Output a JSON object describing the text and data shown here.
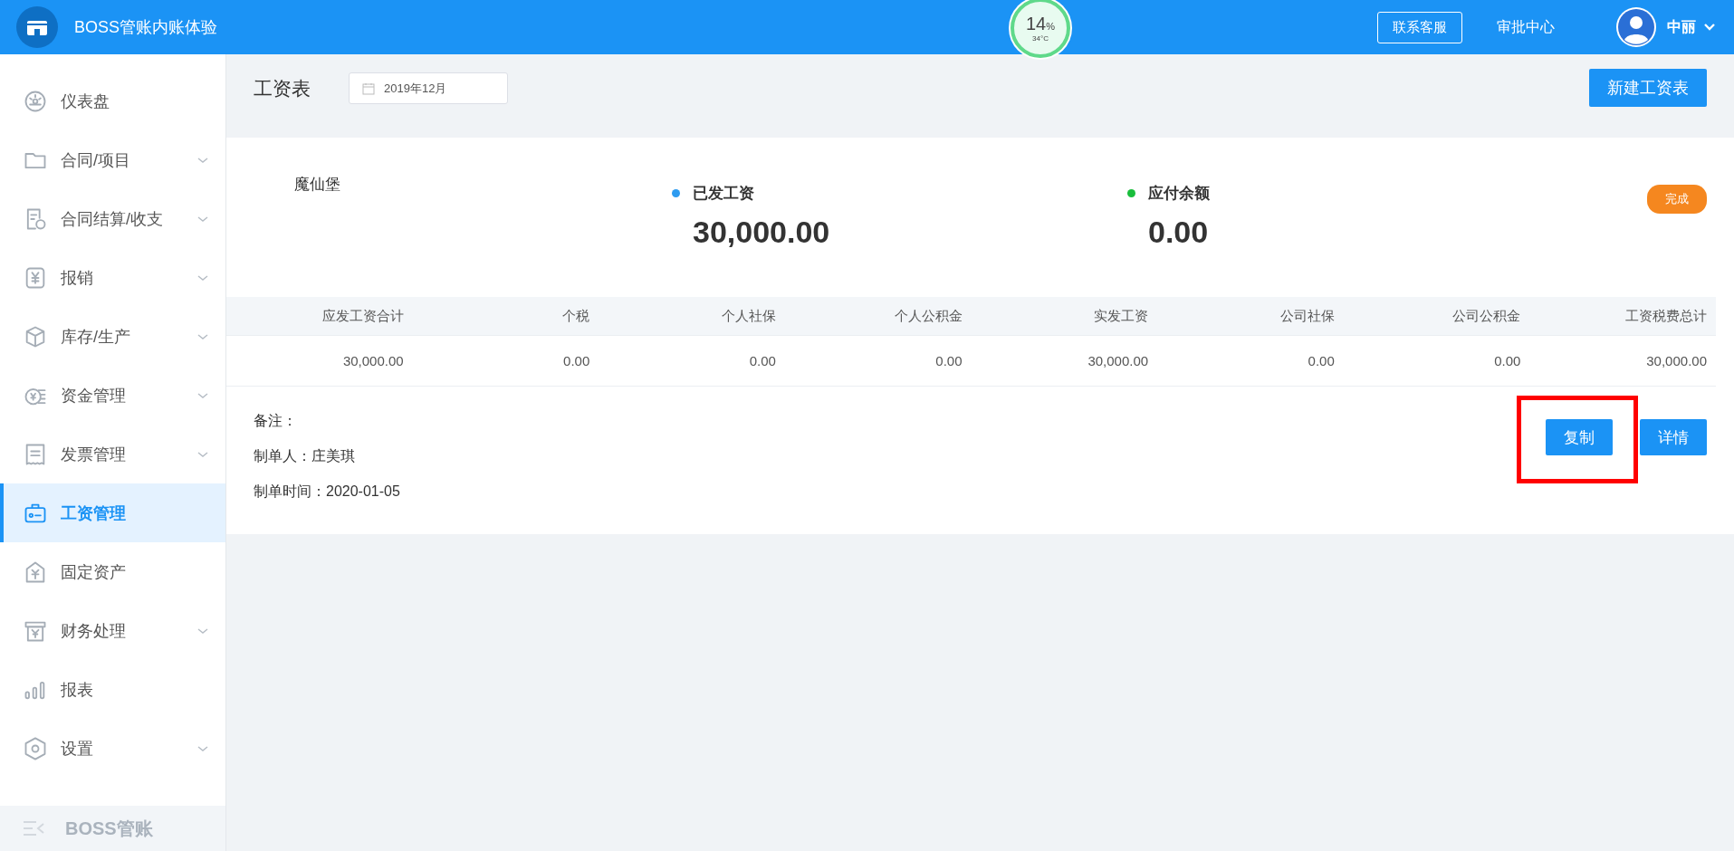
{
  "header": {
    "title": "BOSS管账内账体验",
    "gauge": {
      "value": "14",
      "unit": "%",
      "temperature": "34°C"
    },
    "service_button": "联系客服",
    "approval_link": "审批中心",
    "user": "中丽"
  },
  "sidebar": {
    "items": [
      {
        "label": "仪表盘",
        "expandable": false,
        "selected": false
      },
      {
        "label": "合同/项目",
        "expandable": true,
        "selected": false
      },
      {
        "label": "合同结算/收支",
        "expandable": true,
        "selected": false
      },
      {
        "label": "报销",
        "expandable": true,
        "selected": false
      },
      {
        "label": "库存/生产",
        "expandable": true,
        "selected": false
      },
      {
        "label": "资金管理",
        "expandable": true,
        "selected": false
      },
      {
        "label": "发票管理",
        "expandable": true,
        "selected": false
      },
      {
        "label": "工资管理",
        "expandable": false,
        "selected": true
      },
      {
        "label": "固定资产",
        "expandable": false,
        "selected": false
      },
      {
        "label": "财务处理",
        "expandable": true,
        "selected": false
      },
      {
        "label": "报表",
        "expandable": false,
        "selected": false
      },
      {
        "label": "设置",
        "expandable": true,
        "selected": false
      }
    ],
    "footer": "BOSS管账"
  },
  "page": {
    "title": "工资表",
    "month": "2019年12月",
    "new_button": "新建工资表"
  },
  "card": {
    "company": "魔仙堡",
    "stats": [
      {
        "label": "已发工资",
        "value": "30,000.00",
        "color": "#2d9bf0"
      },
      {
        "label": "应付余额",
        "value": "0.00",
        "color": "#19be3c"
      }
    ],
    "status": "完成",
    "table": {
      "columns": [
        "应发工资合计",
        "个税",
        "个人社保",
        "个人公积金",
        "实发工资",
        "公司社保",
        "公司公积金",
        "工资税费总计"
      ],
      "rows": [
        [
          "30,000.00",
          "0.00",
          "0.00",
          "0.00",
          "30,000.00",
          "0.00",
          "0.00",
          "30,000.00"
        ]
      ]
    },
    "notes": [
      {
        "label": "备注："
      },
      {
        "label": "制单人：",
        "value": "庄美琪"
      },
      {
        "label": "制单时间：",
        "value": "2020-01-05"
      }
    ],
    "actions": [
      {
        "label": "复制",
        "highlighted": true
      },
      {
        "label": "详情",
        "highlighted": false
      }
    ]
  }
}
